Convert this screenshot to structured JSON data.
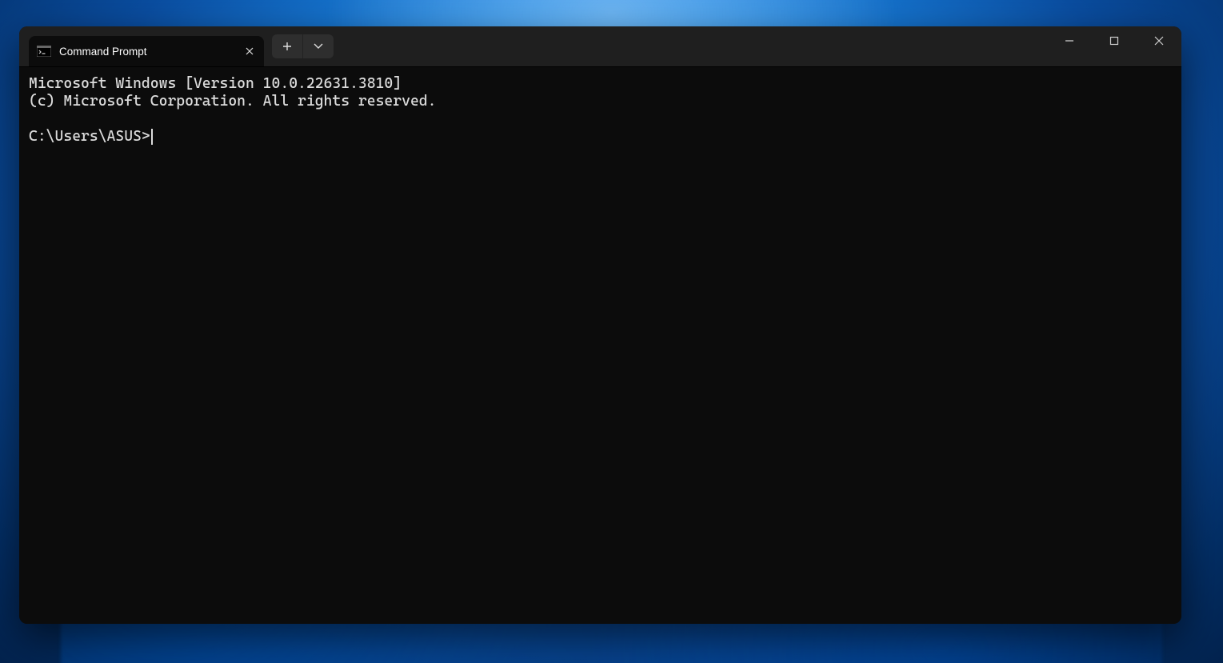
{
  "titlebar": {
    "tab": {
      "title": "Command Prompt"
    }
  },
  "terminal": {
    "line1": "Microsoft Windows [Version 10.0.22631.3810]",
    "line2": "(c) Microsoft Corporation. All rights reserved.",
    "prompt": "C:\\Users\\ASUS>"
  }
}
